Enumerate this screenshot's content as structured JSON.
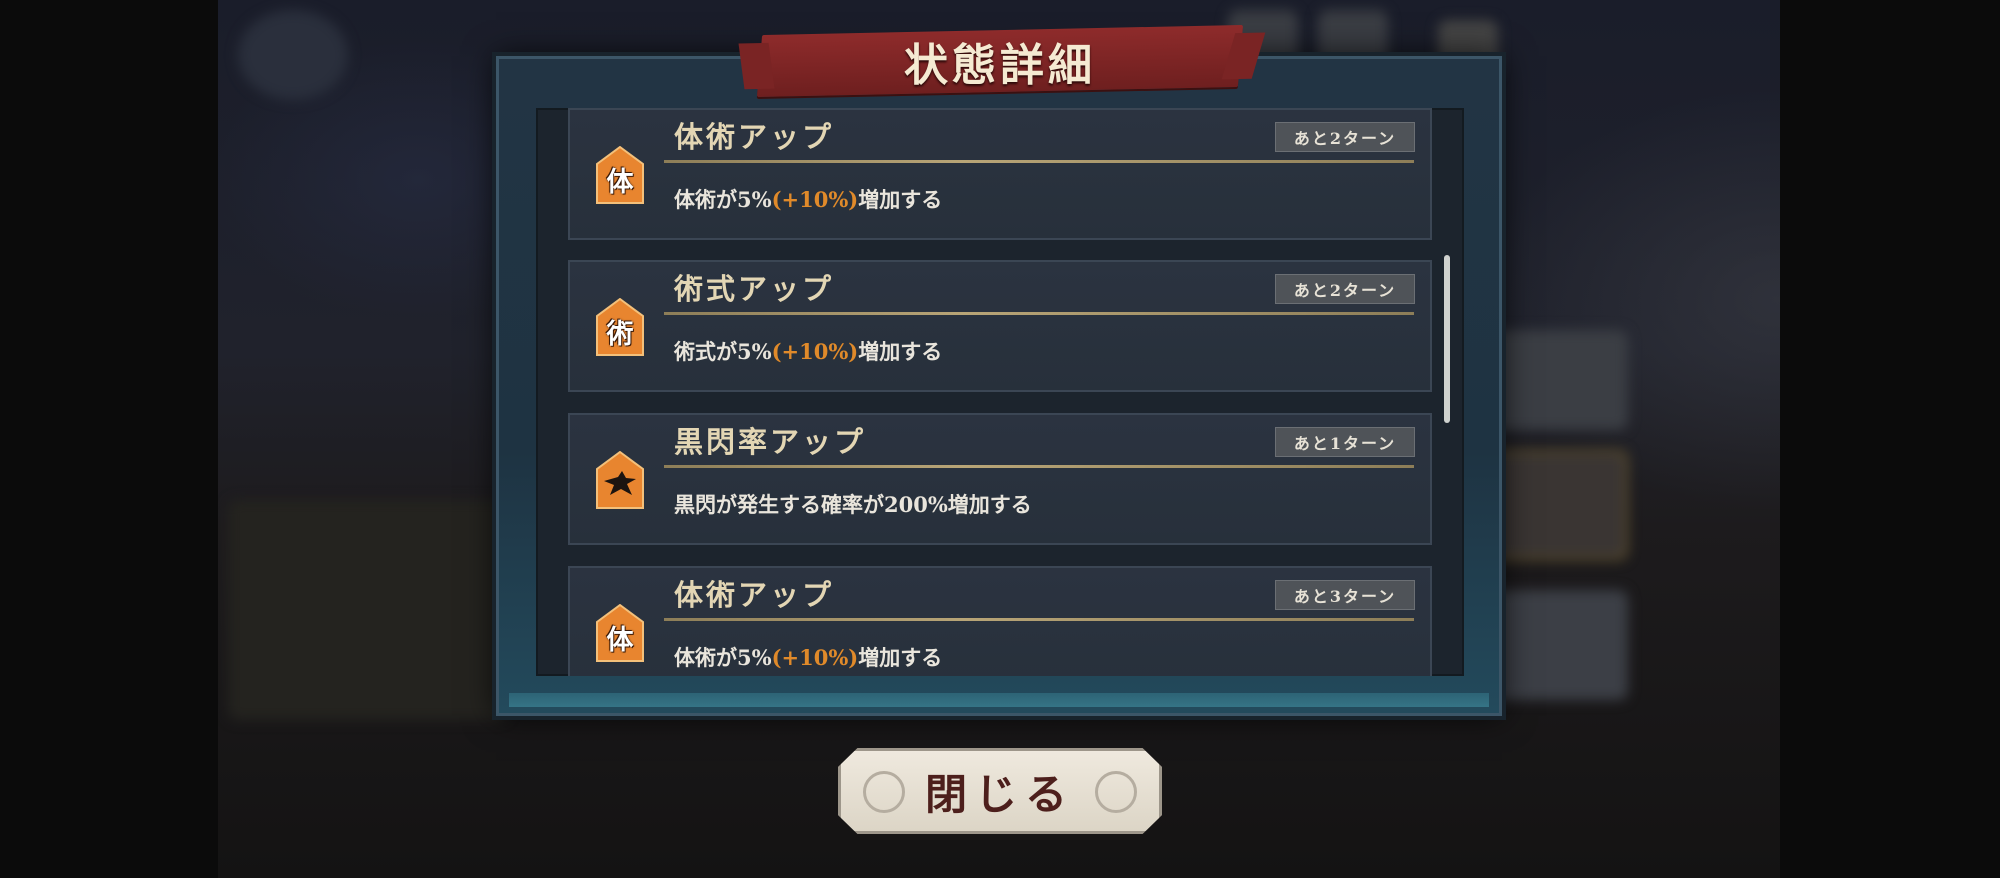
{
  "dialog": {
    "title": "状態詳細",
    "close_label": "閉じる"
  },
  "colors": {
    "highlight": "#e08a2a",
    "title_banner": "#8e2b2b",
    "icon_fill": "#e8852f"
  },
  "effects": [
    {
      "icon": "taijutsu-icon",
      "icon_glyph": "体",
      "name": "体術アップ",
      "turns": "あと2ターン",
      "desc_pre": "体術が5%",
      "desc_hl": "(+10%)",
      "desc_post": "増加する"
    },
    {
      "icon": "jutsushiki-icon",
      "icon_glyph": "術",
      "name": "術式アップ",
      "turns": "あと2ターン",
      "desc_pre": "術式が5%",
      "desc_hl": "(+10%)",
      "desc_post": "増加する"
    },
    {
      "icon": "black-flash-icon",
      "icon_glyph": "",
      "name": "黒閃率アップ",
      "turns": "あと1ターン",
      "desc_pre": "黒閃が発生する確率が200%増加する",
      "desc_hl": "",
      "desc_post": ""
    },
    {
      "icon": "taijutsu-icon",
      "icon_glyph": "体",
      "name": "体術アップ",
      "turns": "あと3ターン",
      "desc_pre": "体術が5%",
      "desc_hl": "(+10%)",
      "desc_post": "増加する"
    }
  ]
}
